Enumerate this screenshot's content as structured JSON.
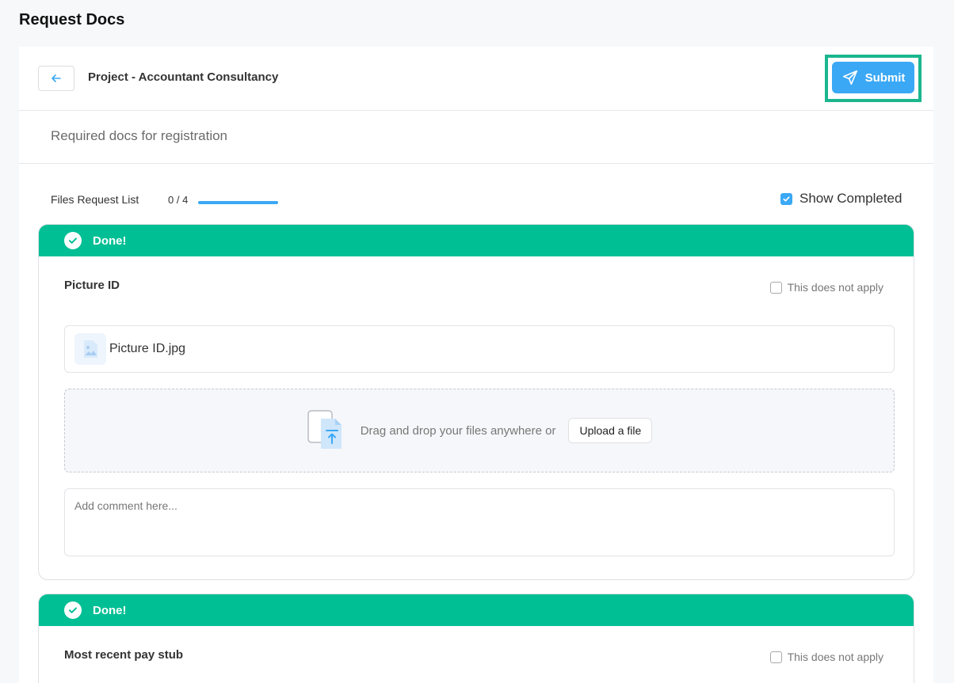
{
  "page_title": "Request Docs",
  "header": {
    "back_icon": "arrow-left-icon",
    "project_title": "Project - Accountant Consultancy",
    "submit_label": "Submit",
    "submit_icon": "send-icon"
  },
  "subheader": {
    "text": "Required docs for registration"
  },
  "files_list": {
    "label": "Files Request List",
    "count": "0 / 4",
    "progress": 1.0,
    "show_completed_label": "Show Completed",
    "show_completed_checked": true
  },
  "cards": [
    {
      "status": "Done!",
      "title": "Picture ID",
      "not_apply_label": "This does not apply",
      "file_name": "Picture ID.jpg",
      "drop_text": "Drag and drop your files anywhere or",
      "upload_label": "Upload a file",
      "comment_placeholder": "Add comment here..."
    },
    {
      "status": "Done!",
      "title": "Most recent pay stub",
      "not_apply_label": "This does not apply"
    }
  ],
  "colors": {
    "accent_blue": "#3aa8f5",
    "done_green": "#00bf95",
    "highlight_green": "#1bb68e"
  }
}
